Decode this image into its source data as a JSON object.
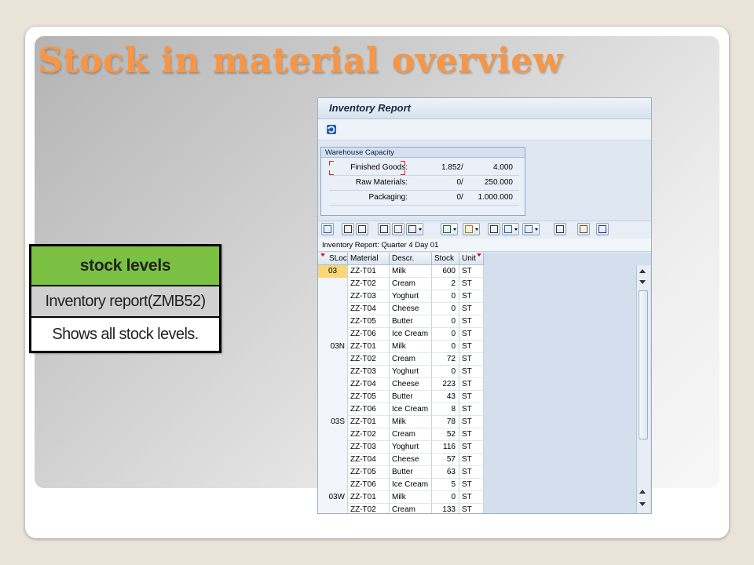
{
  "slide": {
    "title": "Stock in material overview"
  },
  "stock_box": {
    "header": "stock levels",
    "transaction": "Inventory report(ZMB52)",
    "description": "Shows all stock levels."
  },
  "sap": {
    "title": "Inventory Report",
    "warehouse": {
      "header": "Warehouse Capacity",
      "rows": [
        {
          "label": "Finished Goods:",
          "used": "1.852",
          "slash": "/",
          "capacity": "4.000"
        },
        {
          "label": "Raw Materials:",
          "used": "0",
          "slash": "/",
          "capacity": "250.000"
        },
        {
          "label": "Packaging:",
          "used": "0",
          "slash": "/",
          "capacity": "1.000.000"
        }
      ]
    },
    "alv_caption": "Inventory Report: Quarter 4 Day 01",
    "columns": {
      "sloc": "SLoc",
      "material": "Material",
      "descr": "Descr.",
      "stock": "Stock",
      "unit": "Unit"
    },
    "rows": [
      {
        "sloc": "03",
        "material": "ZZ-T01",
        "descr": "Milk",
        "stock": "600",
        "unit": "ST"
      },
      {
        "sloc": "",
        "material": "ZZ-T02",
        "descr": "Cream",
        "stock": "2",
        "unit": "ST"
      },
      {
        "sloc": "",
        "material": "ZZ-T03",
        "descr": "Yoghurt",
        "stock": "0",
        "unit": "ST"
      },
      {
        "sloc": "",
        "material": "ZZ-T04",
        "descr": "Cheese",
        "stock": "0",
        "unit": "ST"
      },
      {
        "sloc": "",
        "material": "ZZ-T05",
        "descr": "Butter",
        "stock": "0",
        "unit": "ST"
      },
      {
        "sloc": "",
        "material": "ZZ-T06",
        "descr": "Ice Cream",
        "stock": "0",
        "unit": "ST"
      },
      {
        "sloc": "03N",
        "material": "ZZ-T01",
        "descr": "Milk",
        "stock": "0",
        "unit": "ST"
      },
      {
        "sloc": "",
        "material": "ZZ-T02",
        "descr": "Cream",
        "stock": "72",
        "unit": "ST"
      },
      {
        "sloc": "",
        "material": "ZZ-T03",
        "descr": "Yoghurt",
        "stock": "0",
        "unit": "ST"
      },
      {
        "sloc": "",
        "material": "ZZ-T04",
        "descr": "Cheese",
        "stock": "223",
        "unit": "ST"
      },
      {
        "sloc": "",
        "material": "ZZ-T05",
        "descr": "Butter",
        "stock": "43",
        "unit": "ST"
      },
      {
        "sloc": "",
        "material": "ZZ-T06",
        "descr": "Ice Cream",
        "stock": "8",
        "unit": "ST"
      },
      {
        "sloc": "03S",
        "material": "ZZ-T01",
        "descr": "Milk",
        "stock": "78",
        "unit": "ST"
      },
      {
        "sloc": "",
        "material": "ZZ-T02",
        "descr": "Cream",
        "stock": "52",
        "unit": "ST"
      },
      {
        "sloc": "",
        "material": "ZZ-T03",
        "descr": "Yoghurt",
        "stock": "116",
        "unit": "ST"
      },
      {
        "sloc": "",
        "material": "ZZ-T04",
        "descr": "Cheese",
        "stock": "57",
        "unit": "ST"
      },
      {
        "sloc": "",
        "material": "ZZ-T05",
        "descr": "Butter",
        "stock": "63",
        "unit": "ST"
      },
      {
        "sloc": "",
        "material": "ZZ-T06",
        "descr": "Ice Cream",
        "stock": "5",
        "unit": "ST"
      },
      {
        "sloc": "03W",
        "material": "ZZ-T01",
        "descr": "Milk",
        "stock": "0",
        "unit": "ST"
      },
      {
        "sloc": "",
        "material": "ZZ-T02",
        "descr": "Cream",
        "stock": "133",
        "unit": "ST"
      }
    ],
    "toolbar_icons": [
      "details-icon",
      "sort-ascending-icon",
      "sort-descending-icon",
      "find-icon",
      "find-next-icon",
      "filter-icon",
      "sum-icon",
      "subtotal-icon",
      "print-preview-icon",
      "export-icon",
      "spreadsheet-icon",
      "layout-icon",
      "select-layout-icon",
      "info-icon"
    ]
  },
  "colors": {
    "title": "#f79646",
    "stock_header_bg": "#7ac143",
    "selected_sloc": "#f9d778",
    "sap_background": "#dfe8f2"
  }
}
